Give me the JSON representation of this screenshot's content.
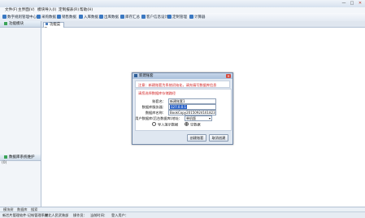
{
  "title_bar": {
    "minimize": "—",
    "maximize": "□",
    "close": "✕"
  },
  "menu": [
    "文件(F)",
    "主界面(V)",
    "模块导入(I)",
    "定制报表(R)",
    "帮助(H)"
  ],
  "toolbar": [
    {
      "label": "数字规则管理中心",
      "icon": "rules-icon",
      "color": "#3a78c2"
    },
    {
      "label": "采购数据",
      "icon": "purchase-icon",
      "color": "#3a78c2"
    },
    {
      "label": "销售数据",
      "icon": "sales-icon",
      "color": "#3a78c2"
    },
    {
      "label": "入库数据",
      "icon": "stock-in-icon",
      "color": "#3a78c2"
    },
    {
      "label": "出库数据",
      "icon": "stock-out-icon",
      "color": "#3a78c2"
    },
    {
      "label": "库存汇总",
      "icon": "inventory-icon",
      "color": "#3a78c2"
    },
    {
      "label": "客户信息设计",
      "icon": "customer-icon",
      "color": "#3a78c2"
    },
    {
      "label": "定制管理",
      "icon": "customize-icon",
      "color": "#3a78c2"
    },
    {
      "label": "计算器",
      "icon": "calculator-icon",
      "color": "#3a78c2"
    }
  ],
  "left_panel": {
    "header": "功能模块",
    "bottom_header": "数据库系统维护",
    "bottom_count": "(0)"
  },
  "main_tab": "功能菜单",
  "bottom_tabs": [
    "模块树",
    "数据库",
    "搜索"
  ],
  "status": [
    "新芯片管理软件-记帐管理系统",
    "湖北人民武装部",
    "操作员：",
    "当前时间：",
    "登入用户："
  ],
  "dialog": {
    "title": "新建账套",
    "banner": "注意：新建账套为系统初始化，请先填写数据库信息",
    "subtitle": "请您选择数据库存储路径",
    "fields": [
      {
        "label": "账套名：",
        "value": "新建账套1"
      },
      {
        "label": "数据库服务器：",
        "value": "127.0.0.1"
      },
      {
        "label": "数据库名称：",
        "value": "BookCopy20150924161823"
      },
      {
        "label": "用户数据库(后台数据库)地址：",
        "value": "单机版"
      }
    ],
    "radio_options": [
      {
        "label": "导入演示数据",
        "selected": false
      },
      {
        "label": "空数据",
        "selected": true
      }
    ],
    "buttons": {
      "create": "创建账套",
      "cancel": "取消创建"
    },
    "colors": {
      "warning": "#d02020",
      "highlight": "#2b63c9"
    }
  }
}
